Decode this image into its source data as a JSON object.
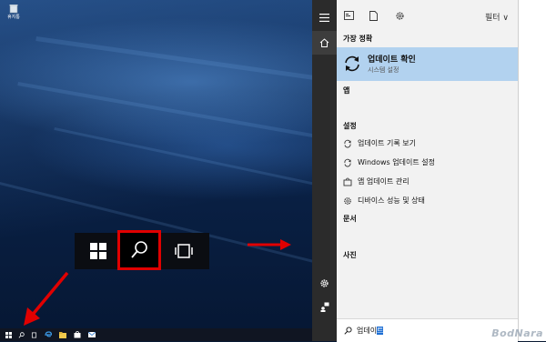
{
  "desktop": {
    "recycle_label": "휴지통"
  },
  "start_menu": {
    "filter_label": "필터 ∨",
    "best_match_heading": "가장 정확",
    "best_match": {
      "title": "업데이트 확인",
      "subtitle": "시스템 설정"
    },
    "apps_heading": "앱",
    "settings_heading": "설정",
    "settings_items": [
      {
        "label": "업데이트 기록 보기",
        "icon": "refresh-icon"
      },
      {
        "label": "Windows 업데이트 설정",
        "icon": "refresh-icon"
      },
      {
        "label": "앱 업데이트 관리",
        "icon": "store-icon"
      },
      {
        "label": "디바이스 성능 및 상태",
        "icon": "gear-icon"
      }
    ],
    "documents_heading": "문서",
    "photos_heading": "사진",
    "search": {
      "typed": "업데이",
      "selected": "트"
    }
  },
  "watermark": "BodNara",
  "colors": {
    "highlight": "#b2d2ef",
    "annotation_red": "#e00000",
    "rail": "#2b2b2b"
  }
}
